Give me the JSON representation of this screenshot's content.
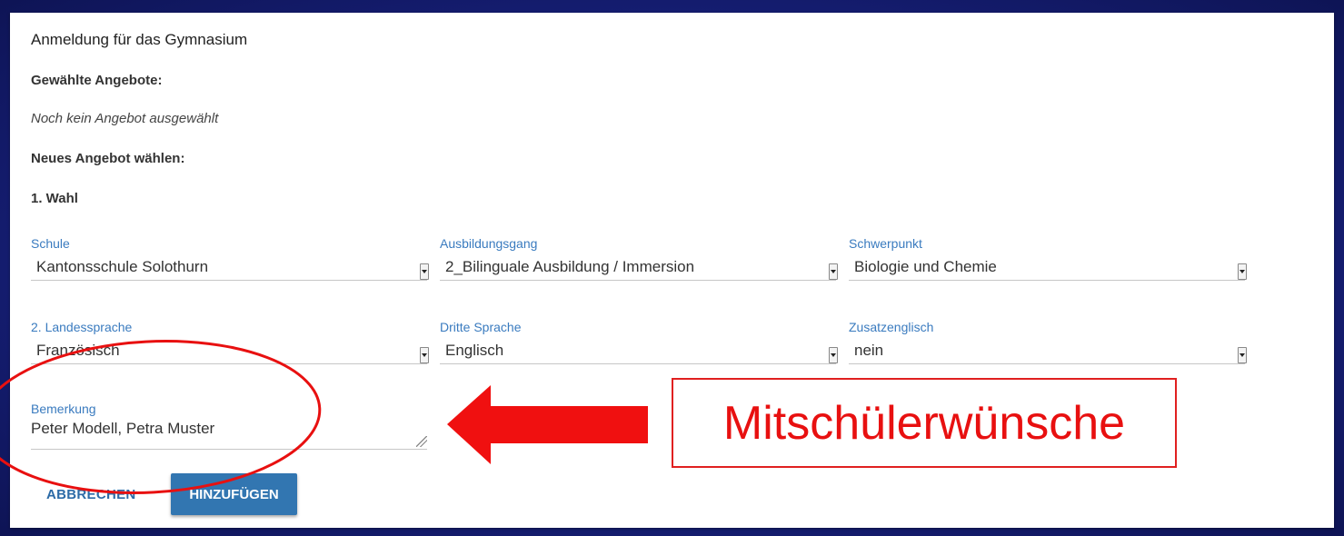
{
  "form": {
    "title": "Anmeldung für das Gymnasium",
    "selected_heading": "Gewählte Angebote:",
    "selected_empty": "Noch kein Angebot ausgewählt",
    "new_heading": "Neues Angebot wählen:",
    "choice_heading": "1. Wahl",
    "fields": {
      "schule": {
        "label": "Schule",
        "value": "Kantonsschule Solothurn"
      },
      "ausbildungsgang": {
        "label": "Ausbildungsgang",
        "value": "2_Bilinguale Ausbildung / Immersion"
      },
      "schwerpunkt": {
        "label": "Schwerpunkt",
        "value": "Biologie und Chemie"
      },
      "landessprache": {
        "label": "2. Landessprache",
        "value": "Französisch"
      },
      "dritte_sprache": {
        "label": "Dritte Sprache",
        "value": "Englisch"
      },
      "zusatzenglisch": {
        "label": "Zusatzenglisch",
        "value": "nein"
      }
    },
    "bemerkung": {
      "label": "Bemerkung",
      "value": "Peter Modell, Petra Muster"
    },
    "buttons": {
      "cancel": "ABBRECHEN",
      "add": "HINZUFÜGEN"
    }
  },
  "annotation": {
    "text": "Mitschülerwünsche",
    "color": "#e81010"
  },
  "colors": {
    "label_blue": "#3a7bbf",
    "primary_button": "#3276b1",
    "background": "#16207a"
  }
}
